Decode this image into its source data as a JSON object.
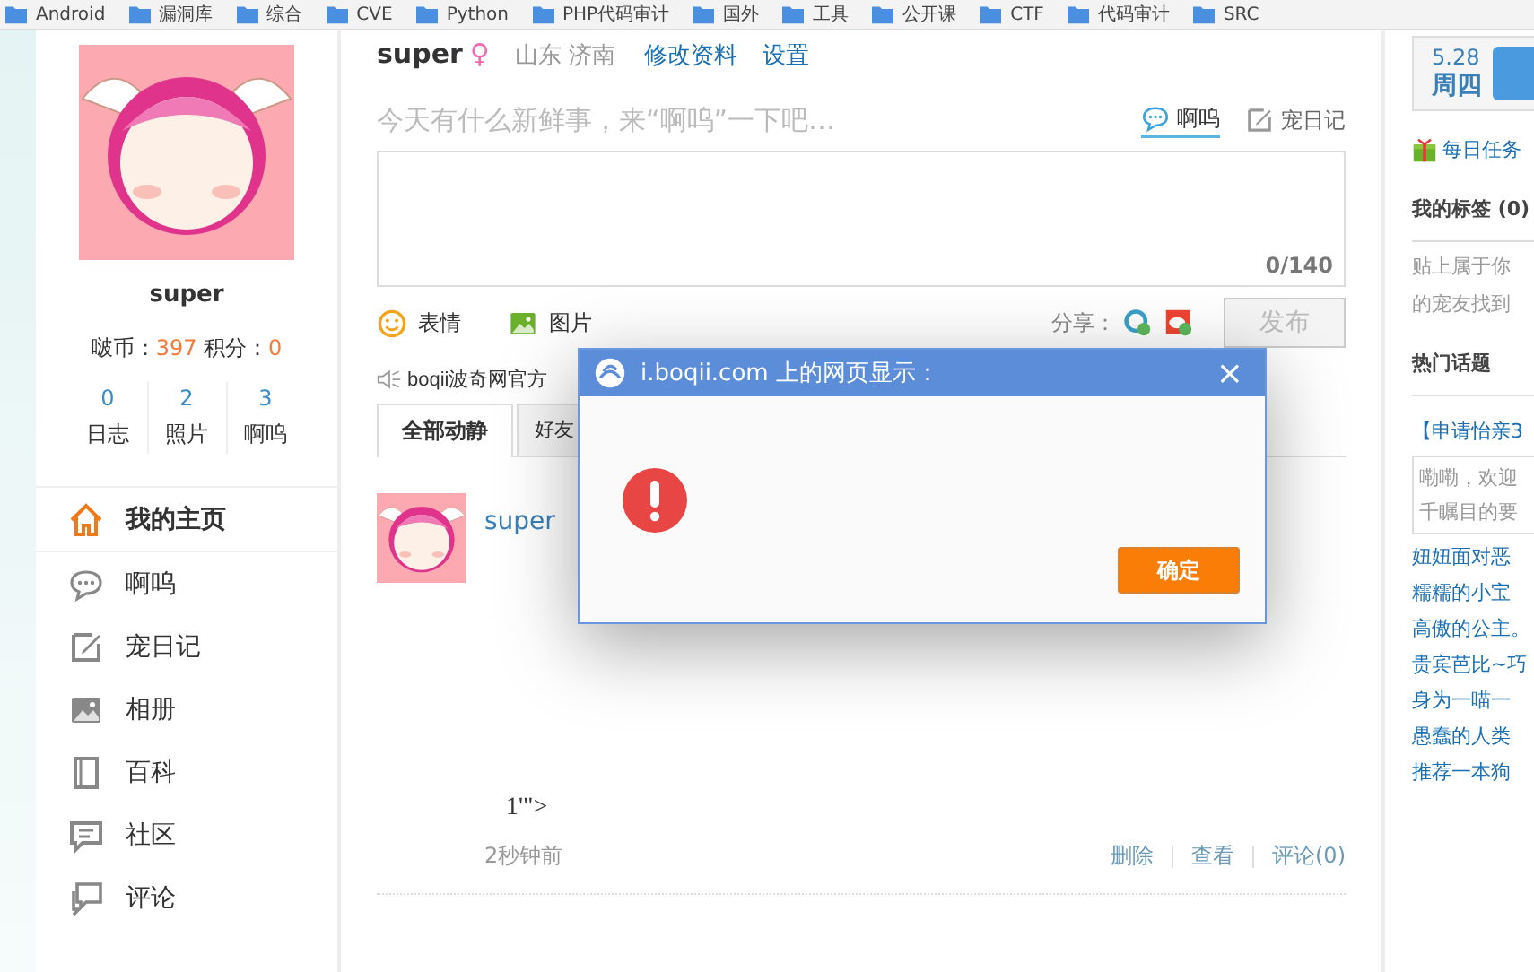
{
  "bookmarks": [
    {
      "label": "Android"
    },
    {
      "label": "漏洞库"
    },
    {
      "label": "综合"
    },
    {
      "label": "CVE"
    },
    {
      "label": "Python"
    },
    {
      "label": "PHP代码审计"
    },
    {
      "label": "国外"
    },
    {
      "label": "工具"
    },
    {
      "label": "公开课"
    },
    {
      "label": "CTF"
    },
    {
      "label": "代码审计"
    },
    {
      "label": "SRC"
    }
  ],
  "profile": {
    "name": "super",
    "coins_label": "啵币：",
    "coins": "397",
    "points_label": "积分：",
    "points": "0",
    "stats": [
      {
        "value": "0",
        "label": "日志"
      },
      {
        "value": "2",
        "label": "照片"
      },
      {
        "value": "3",
        "label": "啊呜"
      }
    ]
  },
  "nav": [
    {
      "label": "我的主页",
      "selected": true
    },
    {
      "label": "啊呜",
      "selected": false
    },
    {
      "label": "宠日记",
      "selected": false
    },
    {
      "label": "相册",
      "selected": false
    },
    {
      "label": "百科",
      "selected": false
    },
    {
      "label": "社区",
      "selected": false
    },
    {
      "label": "评论",
      "selected": false
    }
  ],
  "header": {
    "name": "super",
    "gender": "♀",
    "location": "山东 济南",
    "links": [
      "修改资料",
      "设置"
    ]
  },
  "composer": {
    "prompt": "今天有什么新鲜事，来“啊呜”一下吧…",
    "modes": [
      {
        "label": "啊呜",
        "selected": true
      },
      {
        "label": "宠日记",
        "selected": false
      }
    ],
    "counter": "0/140",
    "tools": [
      {
        "label": "表情"
      },
      {
        "label": "图片"
      }
    ],
    "share_label": "分享：",
    "submit": "发布",
    "submit_disabled": true
  },
  "notice": "boqii波奇网官方",
  "feed_tabs": [
    {
      "label": "全部动静",
      "selected": true
    },
    {
      "label": "好友",
      "selected": false
    }
  ],
  "post": {
    "author": "super",
    "content": "1'\">",
    "time": "2秒钟前",
    "actions": [
      "删除",
      "查看",
      "评论(0)"
    ]
  },
  "date": {
    "day": "5.28",
    "weekday": "周四"
  },
  "right": {
    "task": "每日任务",
    "tags_title": "我的标签 (0)",
    "tags_hint": [
      "贴上属于你",
      "的宠友找到"
    ],
    "hot_title": "热门话题",
    "featured": "【申请怡亲3",
    "featured_excerpt": [
      "嘞嘞，欢迎",
      "千瞩目的要"
    ],
    "topics": [
      "妞妞面对恶",
      "糯糯的小宝",
      "高傲的公主。",
      "贵宾芭比~巧",
      "身为一喵一",
      "愚蠢的人类",
      "推荐一本狗"
    ]
  },
  "dialog": {
    "title": "i.boqii.com 上的网页显示：",
    "close": "×",
    "ok": "确定"
  }
}
